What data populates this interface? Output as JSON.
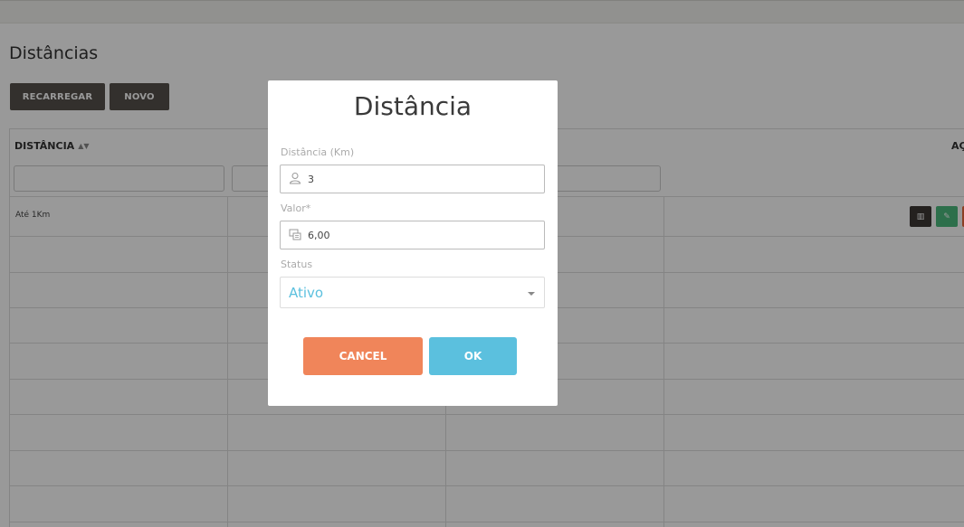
{
  "page": {
    "title": "Distâncias"
  },
  "toolbar": {
    "reload_label": "RECARREGAR",
    "new_label": "NOVO"
  },
  "table": {
    "headers": {
      "distancia": "DISTÂNCIA",
      "acoes": "AÇ"
    },
    "rows": [
      {
        "distancia": "Até 1Km"
      }
    ]
  },
  "modal": {
    "title": "Distância",
    "fields": {
      "distancia": {
        "label": "Distância (Km)",
        "value": "3",
        "icon": "user-icon"
      },
      "valor": {
        "label": "Valor*",
        "value": "6,00",
        "icon": "money-icon"
      },
      "status": {
        "label": "Status",
        "value": "Ativo"
      }
    },
    "cancel_label": "CANCEL",
    "ok_label": "OK"
  },
  "colors": {
    "dark_button": "#56504b",
    "cancel": "#f0855a",
    "ok": "#5bc0de",
    "edit": "#4cba7e",
    "delete": "#ea6a3d"
  }
}
